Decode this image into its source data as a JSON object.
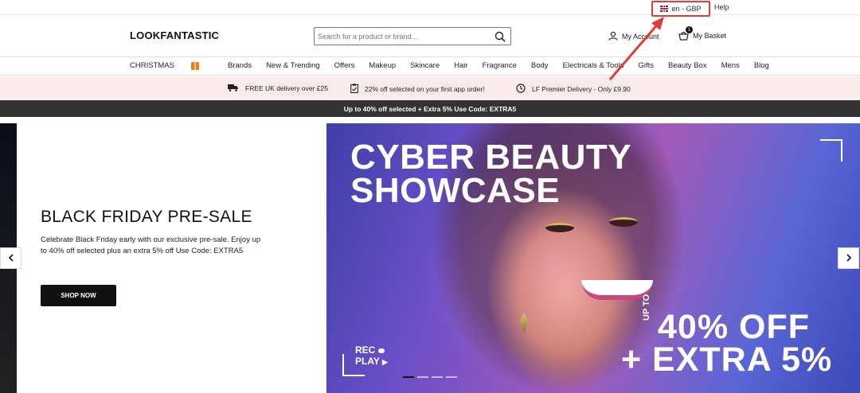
{
  "topbar": {
    "locale": "en - GBP",
    "help": "Help"
  },
  "header": {
    "logo": "LOOKFANTASTIC",
    "search_placeholder": "Search for a product or brand...",
    "account": "My Account",
    "basket": "My Basket",
    "basket_count": "1"
  },
  "nav": {
    "items": [
      "CHRISTMAS",
      "Brands",
      "New & Trending",
      "Offers",
      "Makeup",
      "Skincare",
      "Hair",
      "Fragrance",
      "Body",
      "Electricals & Tools",
      "Gifts",
      "Beauty Box",
      "Mens",
      "Blog"
    ]
  },
  "promo": {
    "delivery": "FREE UK delivery over £25",
    "app": "22% off selected on your first app order!",
    "premier": "LF Premier Delivery - Only £9.90"
  },
  "banner": {
    "text": "Up to 40% off selected + Extra 5% Use Code: EXTRA5"
  },
  "hero": {
    "title": "BLACK FRIDAY PRE-SALE",
    "body": "Celebrate Black Friday early with our exclusive pre-sale. Enjoy up to 40% off selected plus an extra 5% off Use Code: EXTRA5",
    "button": "SHOP NOW",
    "image_title_1": "CYBER BEAUTY",
    "image_title_2": "SHOWCASE",
    "up_to": "UP TO",
    "offer_1": "40% OFF",
    "offer_2": "+ EXTRA 5%",
    "rec": "REC",
    "play": "PLAY"
  },
  "icons": {
    "prev": "chevron-left-icon",
    "next": "chevron-right-icon",
    "search": "search-icon",
    "account": "user-icon",
    "basket": "basket-icon"
  },
  "colors": {
    "annotation": "#e23b3b",
    "promo_bg": "#fbecec",
    "banner_bg": "#333333"
  }
}
